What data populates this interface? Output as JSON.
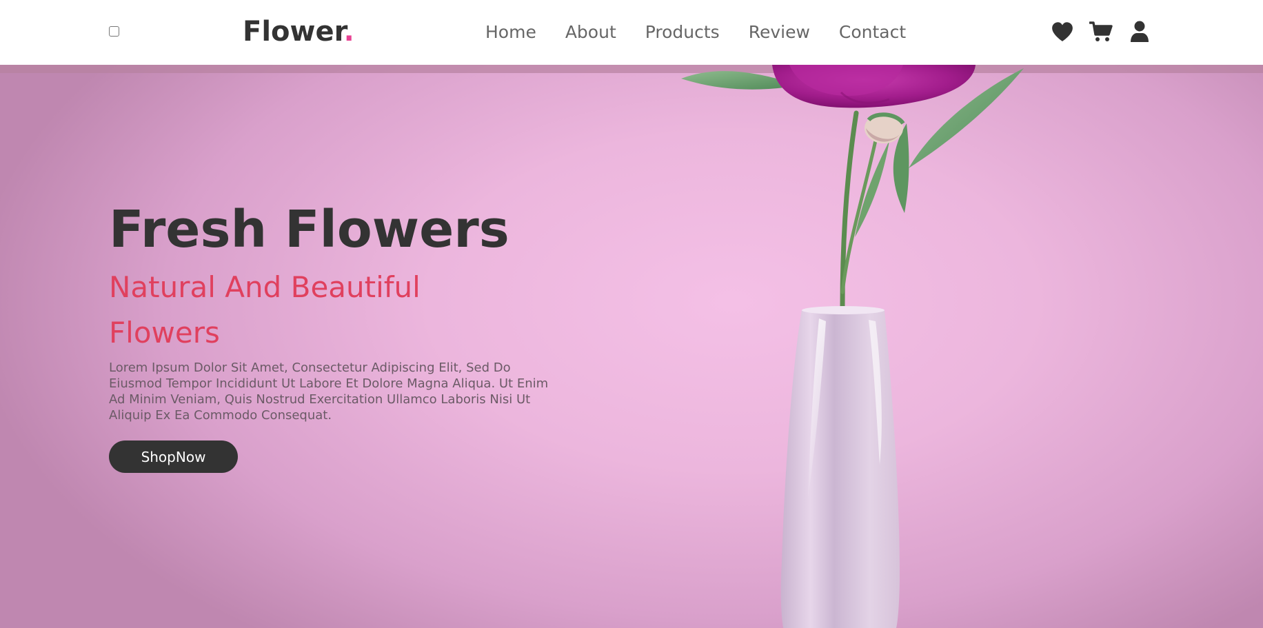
{
  "header": {
    "logo": {
      "text": "Flower",
      "dot": "."
    },
    "nav": [
      {
        "label": "Home"
      },
      {
        "label": "About"
      },
      {
        "label": "Products"
      },
      {
        "label": "Review"
      },
      {
        "label": "Contact"
      }
    ],
    "icons": [
      "heart-icon",
      "cart-icon",
      "user-icon"
    ]
  },
  "hero": {
    "title": "Fresh Flowers",
    "subtitle": "Natural And Beautiful Flowers",
    "description": "Lorem Ipsum Dolor Sit Amet, Consectetur Adipiscing Elit, Sed Do Eiusmod Tempor Incididunt Ut Labore Et Dolore Magna Aliqua. Ut Enim Ad Minim Veniam, Quis Nostrud Exercitation Ullamco Laboris Nisi Ut Aliquip Ex Ea Commodo Consequat.",
    "button_label": "ShopNow"
  },
  "colors": {
    "text_dark": "#333333",
    "accent_pink": "#e84393",
    "subtitle_red": "#e0405e",
    "hero_background": "#efb9e0"
  }
}
